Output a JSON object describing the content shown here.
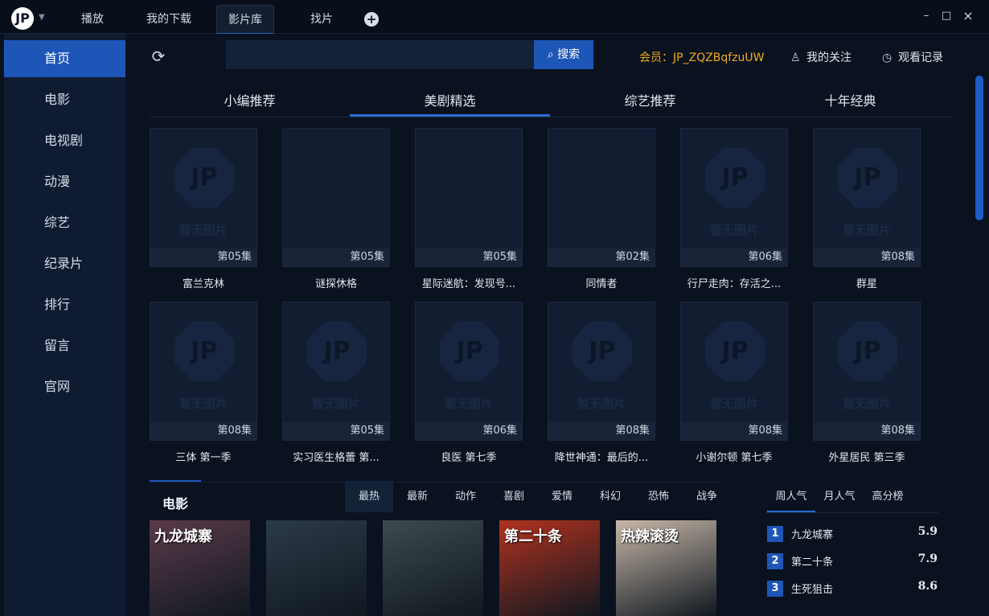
{
  "app": {
    "logo_letter": "JP"
  },
  "tabs": [
    {
      "label": "播放"
    },
    {
      "label": "我的下载"
    },
    {
      "label": "影片库",
      "active": true
    },
    {
      "label": "找片"
    }
  ],
  "window": {
    "minimize": "–",
    "maximize": "□",
    "close": "×"
  },
  "sidebar": {
    "items": [
      {
        "label": "首页",
        "active": true
      },
      {
        "label": "电影"
      },
      {
        "label": "电视剧"
      },
      {
        "label": "动漫"
      },
      {
        "label": "综艺"
      },
      {
        "label": "纪录片"
      },
      {
        "label": "排行"
      },
      {
        "label": "留言"
      },
      {
        "label": "官网"
      }
    ]
  },
  "search": {
    "value": "",
    "button_label": "搜索"
  },
  "header": {
    "vip_text": "会员：JP_ZQZBqfzuUW",
    "follow_label": "我的关注",
    "history_label": "观看记录"
  },
  "rec_tabs": [
    {
      "label": "小编推荐"
    },
    {
      "label": "美剧精选",
      "active": true
    },
    {
      "label": "综艺推荐"
    },
    {
      "label": "十年经典"
    }
  ],
  "placeholder_text": "暂无图片",
  "shows_row1": [
    {
      "title": "富兰克林",
      "episode": "第05集",
      "placeholder": true
    },
    {
      "title": "谜探休格",
      "episode": "第05集",
      "placeholder": false
    },
    {
      "title": "星际迷航：发现号...",
      "episode": "第05集",
      "placeholder": false
    },
    {
      "title": "同情者",
      "episode": "第02集",
      "placeholder": false
    },
    {
      "title": "行尸走肉：存活之...",
      "episode": "第06集",
      "placeholder": true
    },
    {
      "title": "群星",
      "episode": "第08集",
      "placeholder": true
    }
  ],
  "shows_row2": [
    {
      "title": "三体 第一季",
      "episode": "第08集",
      "placeholder": true
    },
    {
      "title": "实习医生格蕾 第...",
      "episode": "第05集",
      "placeholder": true
    },
    {
      "title": "良医 第七季",
      "episode": "第06集",
      "placeholder": true
    },
    {
      "title": "降世神通：最后的...",
      "episode": "第08集",
      "placeholder": true
    },
    {
      "title": "小谢尔顿 第七季",
      "episode": "第08集",
      "placeholder": true
    },
    {
      "title": "外星居民 第三季",
      "episode": "第08集",
      "placeholder": true
    }
  ],
  "movie_section": {
    "title": "电影",
    "genres": [
      {
        "label": "最热",
        "active": true
      },
      {
        "label": "最新"
      },
      {
        "label": "动作"
      },
      {
        "label": "喜剧"
      },
      {
        "label": "爱情"
      },
      {
        "label": "科幻"
      },
      {
        "label": "恐怖"
      },
      {
        "label": "战争"
      }
    ],
    "posters": [
      {
        "overlay": "九龙城寨",
        "color": "#5a3a4a"
      },
      {
        "overlay": "",
        "color": "#2c3a48"
      },
      {
        "overlay": "",
        "color": "#3d4a4f"
      },
      {
        "overlay": "第二十条",
        "color": "#b0321f"
      },
      {
        "overlay": "热辣滚烫",
        "color": "#c7b7a8"
      }
    ]
  },
  "ranking": {
    "tabs": [
      {
        "label": "周人气",
        "active": true
      },
      {
        "label": "月人气"
      },
      {
        "label": "高分榜"
      }
    ],
    "rows": [
      {
        "num": "1",
        "name": "九龙城寨",
        "score": "5.9"
      },
      {
        "num": "2",
        "name": "第二十条",
        "score": "7.9"
      },
      {
        "num": "3",
        "name": "生死狙击",
        "score": "8.6"
      }
    ]
  }
}
